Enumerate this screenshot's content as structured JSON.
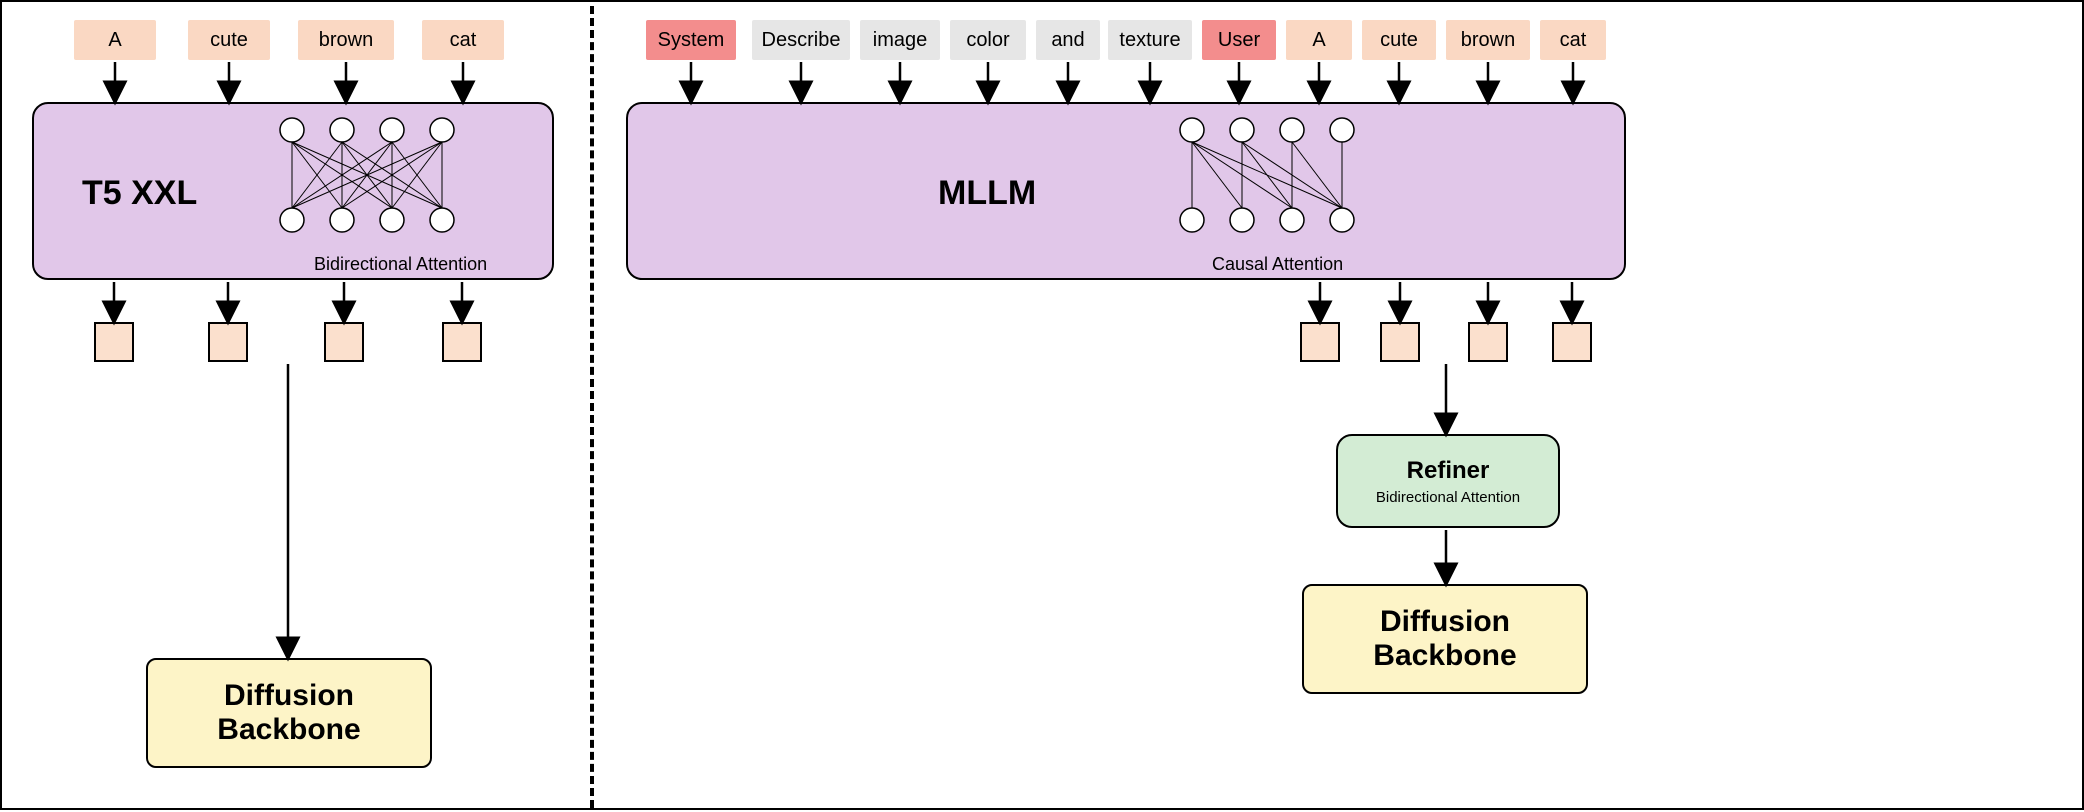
{
  "left": {
    "tokens": [
      "A",
      "cute",
      "brown",
      "cat"
    ],
    "encoder_title": "T5 XXL",
    "attention_caption": "Bidirectional Attention",
    "diffusion_label": "Diffusion\nBackbone"
  },
  "right": {
    "tokens": [
      {
        "text": "System",
        "type": "pink"
      },
      {
        "text": "Describe",
        "type": "gray"
      },
      {
        "text": "image",
        "type": "gray"
      },
      {
        "text": "color",
        "type": "gray"
      },
      {
        "text": "and",
        "type": "gray"
      },
      {
        "text": "texture",
        "type": "gray"
      },
      {
        "text": "User",
        "type": "pink"
      },
      {
        "text": "A",
        "type": "orange"
      },
      {
        "text": "cute",
        "type": "orange"
      },
      {
        "text": "brown",
        "type": "orange"
      },
      {
        "text": "cat",
        "type": "orange"
      }
    ],
    "encoder_title": "MLLM",
    "attention_caption": "Causal Attention",
    "refiner_title": "Refiner",
    "refiner_sub": "Bidirectional Attention",
    "diffusion_label": "Diffusion\nBackbone"
  },
  "colors": {
    "orange": "#fad8c3",
    "gray": "#e6e6e6",
    "pink": "#f38d8d",
    "encoder": "#e1c7e9",
    "refiner": "#d3ecd4",
    "diffusion": "#fdf4c7"
  }
}
